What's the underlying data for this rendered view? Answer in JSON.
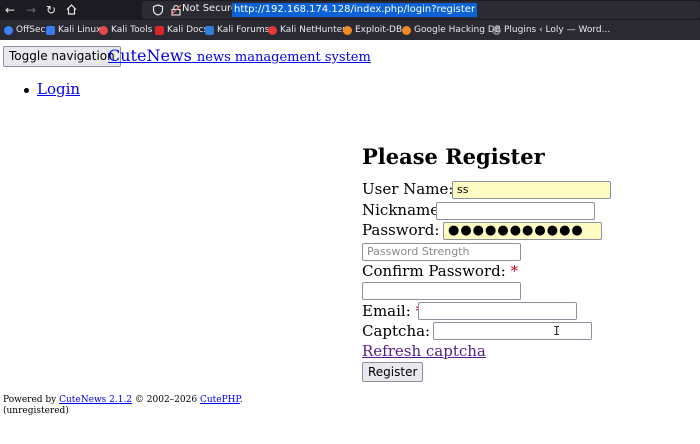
{
  "browser": {
    "security_label": "Not Secure",
    "url": "http://192.168.174.128/index.php/login?register",
    "bookmarks": [
      {
        "label": "OffSec",
        "icon": "offsec-icon",
        "color": "#3b82f6"
      },
      {
        "label": "Kali Linux",
        "icon": "kali-icon",
        "color": "#367bf0"
      },
      {
        "label": "Kali Tools",
        "icon": "kali-tools-icon",
        "color": "#e24a4a"
      },
      {
        "label": "Kali Docs",
        "icon": "kali-docs-icon",
        "color": "#d9262b"
      },
      {
        "label": "Kali Forums",
        "icon": "kali-forums-icon",
        "color": "#2f7ed8"
      },
      {
        "label": "Kali NetHunter",
        "icon": "nethunter-icon",
        "color": "#e63a3a"
      },
      {
        "label": "Exploit-DB",
        "icon": "exploitdb-icon",
        "color": "#f08a24"
      },
      {
        "label": "Google Hacking DB",
        "icon": "ghdb-icon",
        "color": "#f08a24"
      },
      {
        "label": "Plugins ‹ Loly — Word...",
        "icon": "globe-icon",
        "color": "#9aa0a6"
      }
    ]
  },
  "page": {
    "toggle_nav_label": "Toggle navigation",
    "brand_name": "CuteNews",
    "brand_tagline": "news management system",
    "nav_login": "Login"
  },
  "form": {
    "title": "Please Register",
    "username_label": "User Name:",
    "username_value": "ss",
    "nickname_label": "Nickname:",
    "nickname_value": "",
    "password_label": "Password:",
    "password_value": "●●●●●●●●●●●",
    "strength_placeholder": "Password Strength",
    "confirm_label": "Confirm Password:",
    "confirm_value": "",
    "email_label": "Email:",
    "email_value": "",
    "captcha_label": "Captcha:",
    "captcha_value": "",
    "required_mark": "*",
    "refresh_captcha": "Refresh captcha",
    "register_button": "Register"
  },
  "footer": {
    "powered_by": "Powered by",
    "cutenews_link": "CuteNews 2.1.2",
    "copyright": "© 2002–2026",
    "cutephp_link": "CutePHP",
    "period": ".",
    "status": "(unregistered)"
  },
  "colors": {
    "required": "#d0021b",
    "link": "#0000ee",
    "visited_link": "#551a8b",
    "autofill": "#fffdc4"
  }
}
